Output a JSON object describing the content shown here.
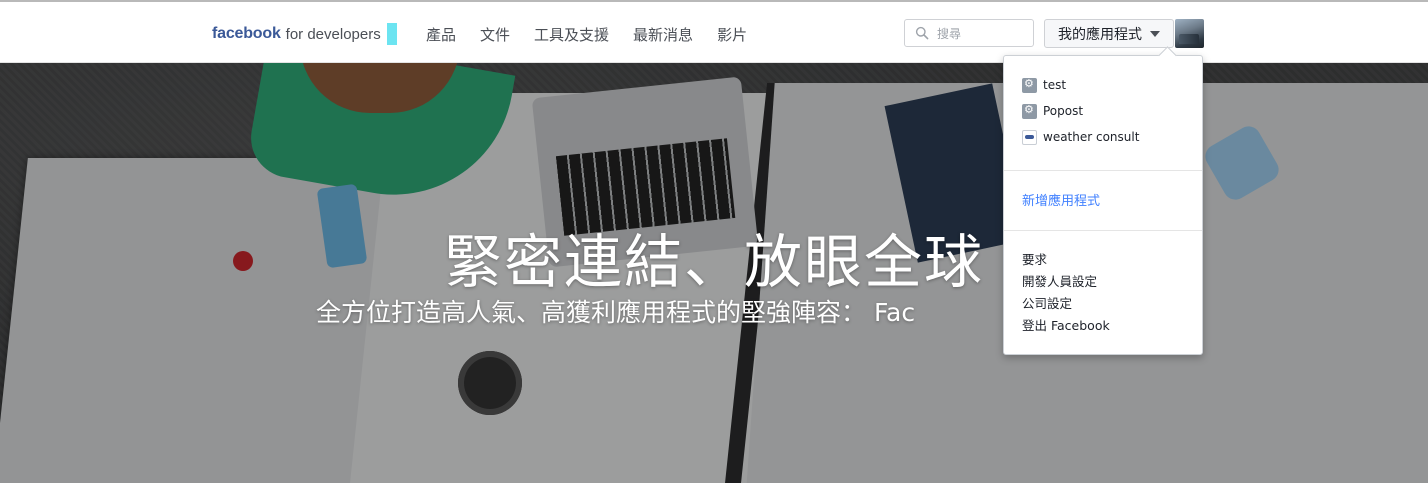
{
  "nav": {
    "brand_bold": "facebook",
    "brand_rest": "for developers",
    "menu": [
      "產品",
      "文件",
      "工具及支援",
      "最新消息",
      "影片"
    ],
    "search_placeholder": "搜尋",
    "my_apps_label": "我的應用程式",
    "colors": {
      "brand": "#3b5998",
      "accent": "#6ce4f1",
      "link": "#4080ff"
    }
  },
  "hero": {
    "headline": "緊密連結、放眼全球",
    "subline": "全方位打造高人氣、高獲利應用程式的堅強陣容： Fac"
  },
  "dropdown": {
    "apps": [
      {
        "name": "test",
        "icon": "gear-icon"
      },
      {
        "name": "Popost",
        "icon": "gear-icon"
      },
      {
        "name": "weather consult",
        "icon": "cloud-icon"
      }
    ],
    "add_app": "新增應用程式",
    "links": [
      "要求",
      "開發人員設定",
      "公司設定",
      "登出 Facebook"
    ]
  }
}
